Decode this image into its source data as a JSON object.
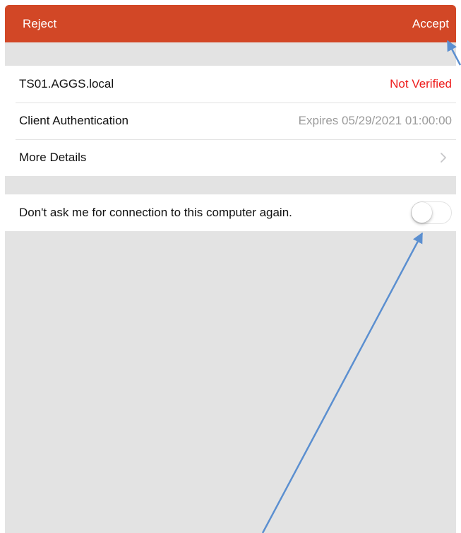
{
  "navbar": {
    "reject_label": "Reject",
    "accept_label": "Accept",
    "background_color": "#d24726"
  },
  "certificate": {
    "rows": [
      {
        "label": "TS01.AGGS.local",
        "value": "Not Verified",
        "value_color": "#ee1c1c"
      },
      {
        "label": "Client Authentication",
        "value": "Expires 05/29/2021 01:00:00"
      },
      {
        "label": "More Details",
        "icon": "chevron-right-icon"
      }
    ]
  },
  "settings": {
    "dont_ask_label": "Don't ask me for connection to this computer again.",
    "dont_ask_enabled": false
  },
  "annotation": {
    "arrow_color": "#5b8fd0"
  }
}
